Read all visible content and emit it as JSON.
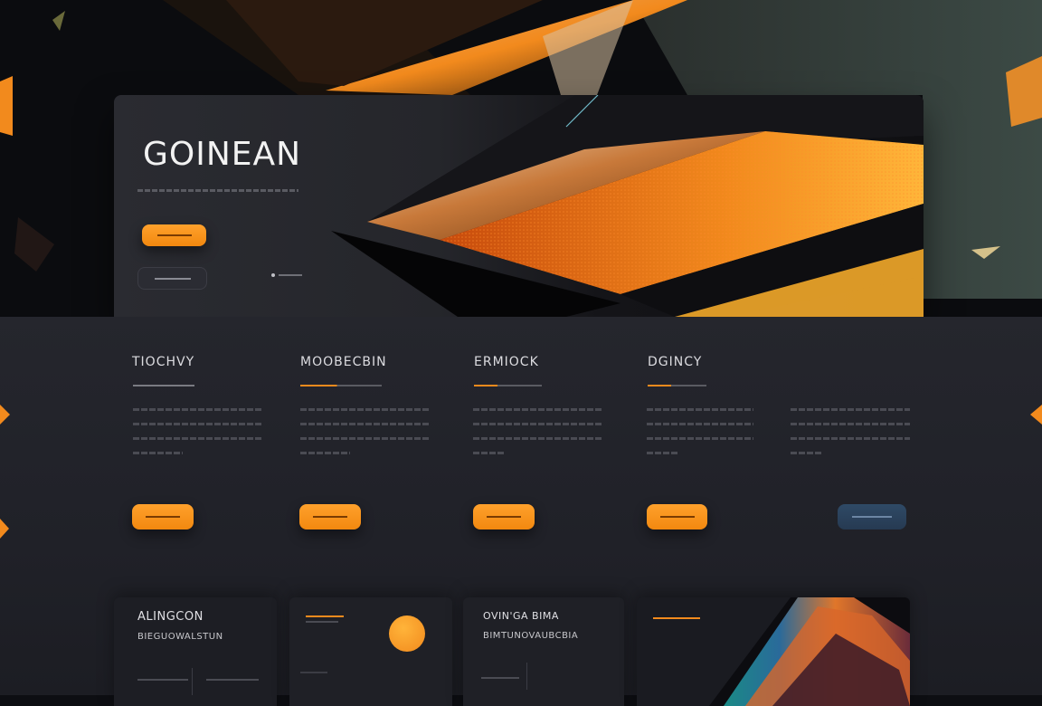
{
  "hero": {
    "title": "GOINEAN",
    "colors": {
      "accent": "#f7941d",
      "panel": "#26272d"
    }
  },
  "columns": [
    {
      "title": "TIOCHVY"
    },
    {
      "title": "MOOBECBIN"
    },
    {
      "title": "ERMIOCK"
    },
    {
      "title": "DGINCY"
    },
    {
      "title": ""
    }
  ],
  "cards": [
    {
      "title": "ALINGCON",
      "subtitle": "BIEGUOWALSTUN"
    },
    {
      "title": ""
    },
    {
      "title": "OVIN'GA BIMA",
      "subtitle": "BIMTUNOVAUBCBIA"
    },
    {
      "title": ""
    }
  ],
  "icons": {
    "accent_circle": "orange-circle-icon",
    "side_arrows": "chevron-icon"
  }
}
